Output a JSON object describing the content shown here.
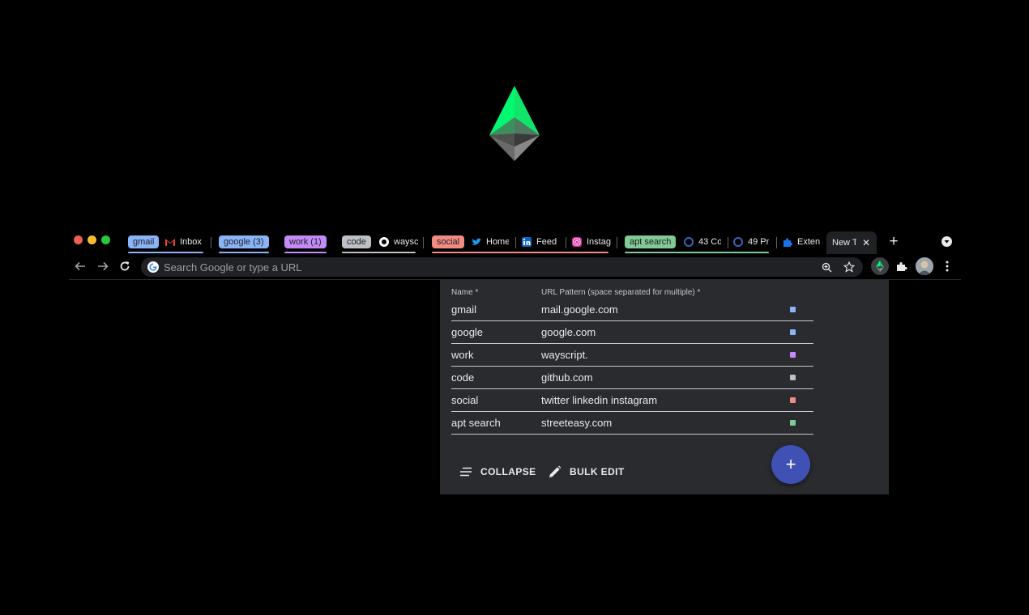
{
  "tab_strip": {
    "groups": [
      {
        "label": "gmail",
        "color": "#8ab4f8"
      },
      {
        "label": "google (3)",
        "color": "#8ab4f8"
      },
      {
        "label": "work (1)",
        "color": "#c58af9"
      },
      {
        "label": "code",
        "color": "#bdc1c6"
      },
      {
        "label": "social",
        "color": "#f28b82"
      },
      {
        "label": "apt search",
        "color": "#81c995"
      }
    ],
    "tabs": [
      {
        "title": "Inbox",
        "icon": "gmail-icon"
      },
      {
        "title": "waysc",
        "icon": "github-icon"
      },
      {
        "title": "Home",
        "icon": "twitter-icon"
      },
      {
        "title": "Feed",
        "icon": "linkedin-icon"
      },
      {
        "title": "Instag",
        "icon": "instagram-icon"
      },
      {
        "title": "43 Co",
        "icon": "streeteasy-icon"
      },
      {
        "title": "49 Pr",
        "icon": "streeteasy-icon"
      },
      {
        "title": "Exten",
        "icon": "puzzle-icon"
      }
    ],
    "active_tab": {
      "title": "New Tab"
    }
  },
  "toolbar": {
    "omnibox_placeholder": "Search Google or type a URL"
  },
  "popup": {
    "headers": {
      "name": "Name *",
      "url": "URL Pattern (space separated for multiple) *"
    },
    "rows": [
      {
        "name": "gmail",
        "url": "mail.google.com",
        "color": "#8ab4f8"
      },
      {
        "name": "google",
        "url": "google.com",
        "color": "#8ab4f8"
      },
      {
        "name": "work",
        "url": "wayscript.",
        "color": "#c58af9"
      },
      {
        "name": "code",
        "url": "github.com",
        "color": "#bdc1c6"
      },
      {
        "name": "social",
        "url": "twitter linkedin instagram",
        "color": "#f28b82"
      },
      {
        "name": "apt search",
        "url": "streeteasy.com",
        "color": "#81c995"
      }
    ],
    "collapse_label": "COLLAPSE",
    "bulk_edit_label": "BULK EDIT",
    "add_label": "+"
  },
  "colors": {
    "logo_green": "#00f870",
    "fab": "#3f51b5",
    "popup_bg": "#292b2f"
  }
}
